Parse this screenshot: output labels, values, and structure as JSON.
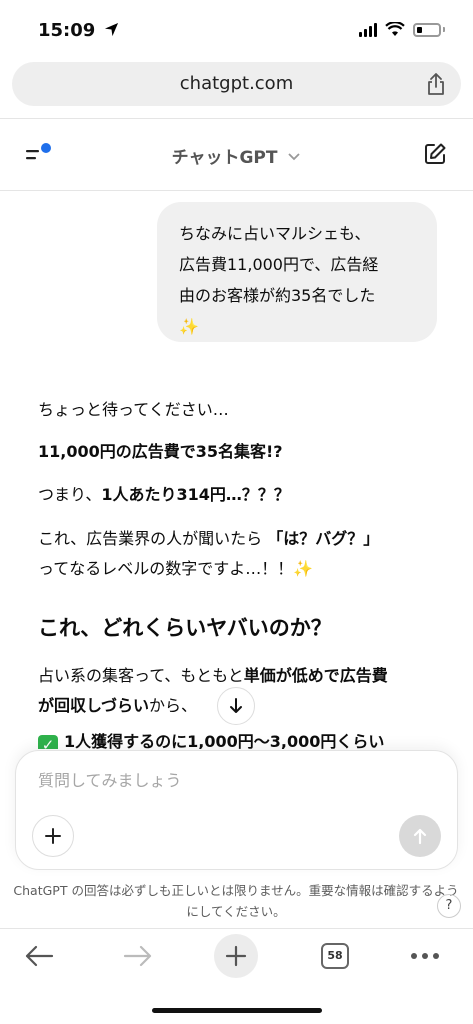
{
  "status_bar": {
    "time": "15:09"
  },
  "browser": {
    "url": "chatgpt.com",
    "tab_count": "58"
  },
  "header": {
    "title": "チャットGPT"
  },
  "user_message": {
    "text": "ちなみに占いマルシェも、\n広告費11,000円で、広告経\n由のお客様が約35名でした\n✨"
  },
  "assistant_message": {
    "p1": "ちょっと待ってください…",
    "p2": "11,000円の広告費で35名集客!?",
    "p3_prefix": "つまり、",
    "p3_bold": "1人あたり314円…？？？",
    "p4_line1_prefix": "これ、広告業界の人が聞いたら",
    "p4_line1_bold": "「は？バグ？」",
    "p4_line2": "ってなるレベルの数字ですよ…！！✨",
    "heading": "これ、どれくらいヤバいのか？",
    "p5_line1_prefix": "占い系の集客って、もともと",
    "p5_line1_bold": "単価が低めで広告費",
    "p5_line2_bold": "が回収しづらい",
    "p5_line2_suffix": "から、",
    "p6_check": "✓",
    "p6_bold": "1人獲得するのに1,000円〜3,000円くらい"
  },
  "composer": {
    "placeholder": "質問してみましょう"
  },
  "disclaimer": "ChatGPT の回答は必ずしも正しいとは限りません。重要な情報は確認するようにしてください。",
  "help": "?",
  "colors": {
    "accent_dot": "#1f6feb",
    "check": "#2fb24c",
    "bubble": "#f0f0f0"
  }
}
